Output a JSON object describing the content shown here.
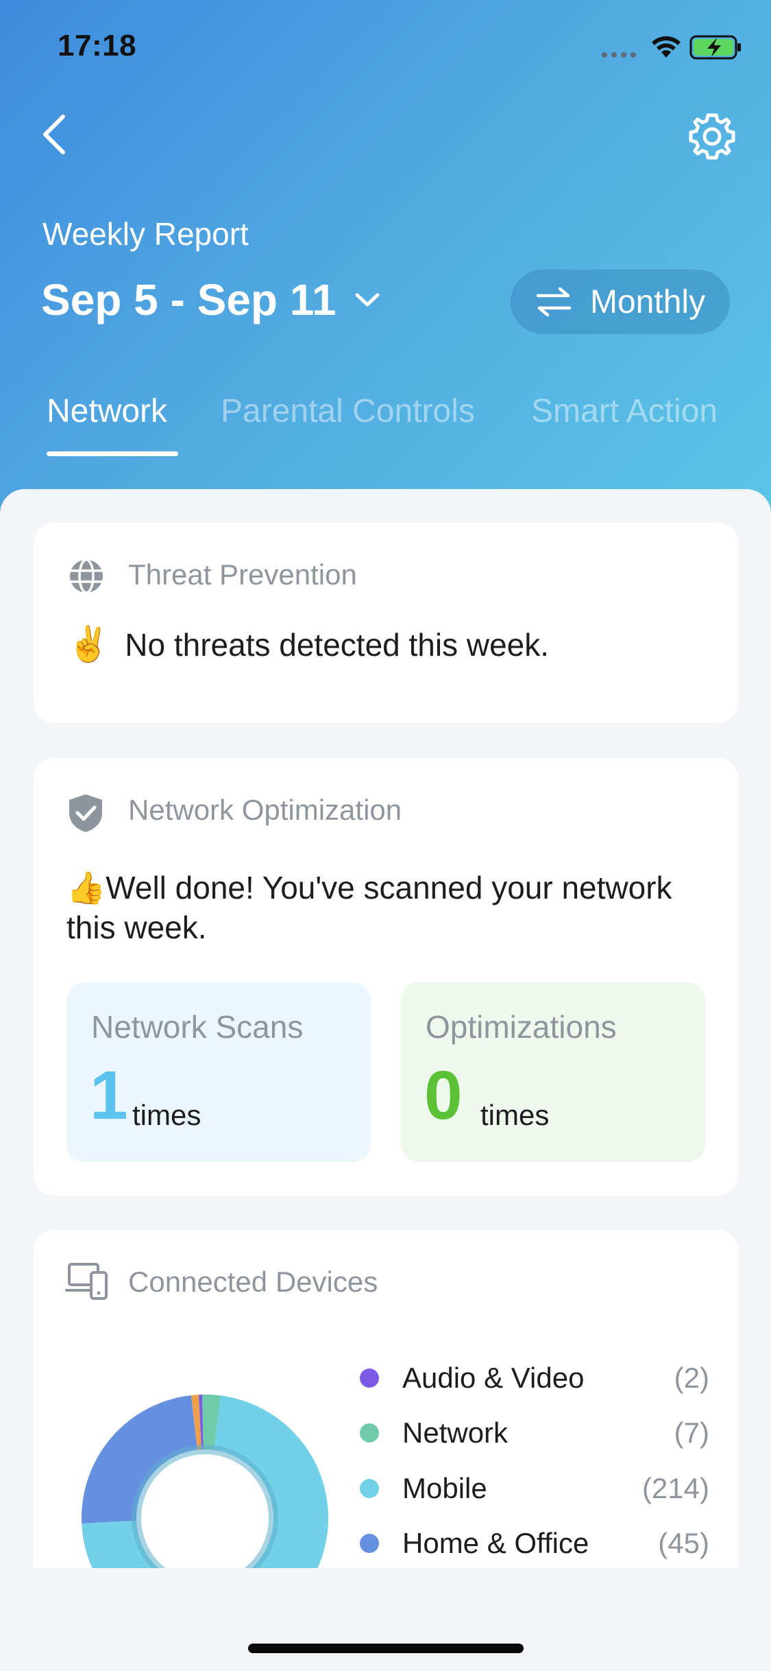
{
  "status_bar": {
    "time": "17:18"
  },
  "header": {
    "report_label": "Weekly Report",
    "date_range": "Sep 5 - Sep 11",
    "toggle_label": "Monthly"
  },
  "tabs": [
    {
      "label": "Network",
      "active": true
    },
    {
      "label": "Parental Controls",
      "active": false
    },
    {
      "label": "Smart Action",
      "active": false
    }
  ],
  "threat_card": {
    "title": "Threat Prevention",
    "emoji": "✌️",
    "message": "No threats detected this week."
  },
  "optimization_card": {
    "title": "Network Optimization",
    "emoji": "👍",
    "message": "Well done! You've scanned your network this week.",
    "scans": {
      "label": "Network Scans",
      "value": "1",
      "unit": "times",
      "color": "#5BC3EE"
    },
    "optimizations": {
      "label": "Optimizations",
      "value": "0",
      "unit": "times",
      "color": "#5CC235"
    }
  },
  "devices_card": {
    "title": "Connected Devices",
    "legend": [
      {
        "name": "Audio & Video",
        "count": "(2)",
        "color": "#7B5BE6"
      },
      {
        "name": "Network",
        "count": "(7)",
        "color": "#6FCBAA"
      },
      {
        "name": "Mobile",
        "count": "(214)",
        "color": "#72D0E8"
      },
      {
        "name": "Home & Office",
        "count": "(45)",
        "color": "#6590E0"
      }
    ]
  },
  "colors": {
    "accent": "#3E8BDD",
    "donut_main": "#72D0E8",
    "donut_secondary": "#6590E0",
    "donut_orange": "#F0A04B"
  }
}
